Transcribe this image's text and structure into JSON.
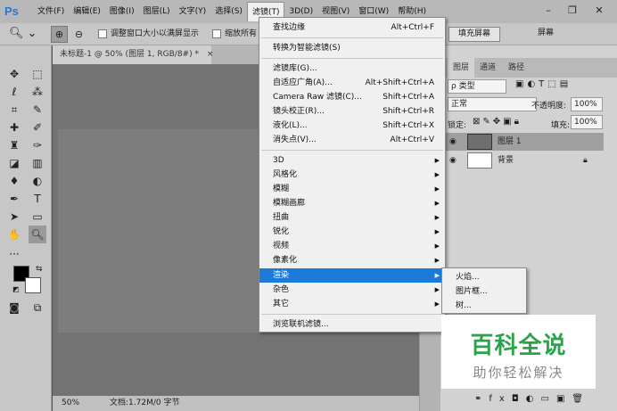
{
  "app": {
    "logo": "Ps"
  },
  "menubar": {
    "items": [
      "文件(F)",
      "编辑(E)",
      "图像(I)",
      "图层(L)",
      "文字(Y)",
      "选择(S)",
      "滤镜(T)",
      "3D(D)",
      "视图(V)",
      "窗口(W)",
      "帮助(H)"
    ],
    "active": "滤镜(T)"
  },
  "options": {
    "checkbox1_label": "调整窗口大小以满屏显示",
    "checkbox2_label": "缩放所有",
    "fill_screen": "填充屏幕",
    "fit_screen": "屏幕"
  },
  "document": {
    "tab_title": "未标题-1 @ 50% (图层 1, RGB/8#) *",
    "tab_close": "×",
    "zoom": "50%",
    "doc_info": "文档:1.72M/0 字节"
  },
  "filter_menu": {
    "items": [
      {
        "label": "查找边缘",
        "shortcut": "Alt+Ctrl+F"
      },
      {
        "label": "转换为智能滤镜(S)",
        "shortcut": ""
      },
      {
        "label": "滤镜库(G)...",
        "shortcut": ""
      },
      {
        "label": "自适应广角(A)...",
        "shortcut": "Alt+Shift+Ctrl+A"
      },
      {
        "label": "Camera Raw 滤镜(C)...",
        "shortcut": "Shift+Ctrl+A"
      },
      {
        "label": "镜头校正(R)...",
        "shortcut": "Shift+Ctrl+R"
      },
      {
        "label": "液化(L)...",
        "shortcut": "Shift+Ctrl+X"
      },
      {
        "label": "消失点(V)...",
        "shortcut": "Alt+Ctrl+V"
      },
      {
        "label": "3D",
        "submenu": true
      },
      {
        "label": "风格化",
        "submenu": true
      },
      {
        "label": "模糊",
        "submenu": true
      },
      {
        "label": "模糊画廊",
        "submenu": true
      },
      {
        "label": "扭曲",
        "submenu": true
      },
      {
        "label": "锐化",
        "submenu": true
      },
      {
        "label": "视频",
        "submenu": true
      },
      {
        "label": "像素化",
        "submenu": true
      },
      {
        "label": "渲染",
        "submenu": true,
        "highlighted": true
      },
      {
        "label": "杂色",
        "submenu": true
      },
      {
        "label": "其它",
        "submenu": true
      },
      {
        "label": "浏览联机滤镜...",
        "shortcut": ""
      }
    ]
  },
  "render_submenu": {
    "items": [
      "火焰...",
      "图片框...",
      "树..."
    ]
  },
  "layers_panel": {
    "tabs": [
      "图层",
      "通道",
      "路径"
    ],
    "filter_kind": "ρ 类型",
    "blend_mode": "正常",
    "opacity_label": "不透明度:",
    "opacity_value": "100%",
    "lock_label": "锁定:",
    "fill_label": "填充:",
    "fill_value": "100%",
    "layers": [
      {
        "name": "图层 1",
        "selected": true
      },
      {
        "name": "背景",
        "locked": true
      }
    ],
    "bottom_icons": [
      "link-icon",
      "fx-icon",
      "mask-icon",
      "adjustment-icon",
      "folder-icon",
      "new-layer-icon",
      "trash-icon"
    ],
    "fx_label": "fx"
  },
  "watermark": {
    "title": "百科全说",
    "subtitle": "助你轻松解决",
    "color": "#2aa44a"
  },
  "colors": {
    "highlight": "#1c7bd6",
    "menu_bg": "#f0f0f0",
    "ps_blue": "#2a76d8"
  }
}
